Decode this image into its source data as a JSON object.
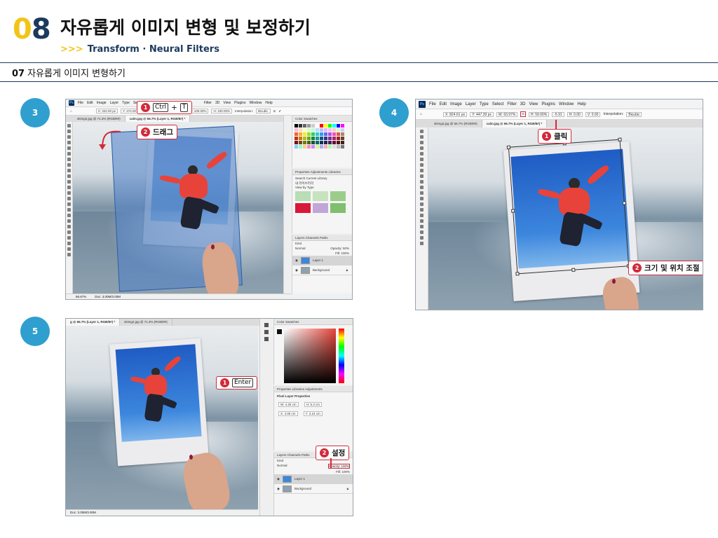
{
  "header": {
    "chapter_num_a": "0",
    "chapter_num_b": "8",
    "chapter_title": "자유롭게 이미지 변형 및 보정하기",
    "arrows": ">>>",
    "chapter_subtitle": "Transform · Neural Filters"
  },
  "section": {
    "number": "07",
    "title": "자유롭게 이미지 변형하기"
  },
  "colors": {
    "accent_yellow": "#f2c417",
    "navy": "#1b3a5c",
    "step_blue": "#2f9fcf",
    "callout_red": "#d12a3a"
  },
  "steps": [
    {
      "badge": "3",
      "menu": [
        "File",
        "Edit",
        "Image",
        "Layer",
        "Type",
        "Select",
        "Filter",
        "3D",
        "View",
        "Plugins",
        "Window",
        "Help"
      ],
      "options": [
        "X: 322.00 px",
        "Y: 474.00 px",
        "W: 100.00%",
        "H: 100.00%",
        "Interpolation:",
        "Bicubic"
      ],
      "tabs": [
        "skimg2.jpg @ 71.3% (RGB/8#)",
        "calm.jpg @ 66.7% (Layer 1, RGB/8#) *"
      ],
      "callout_1_num": "1",
      "callout_1_key_a": "Ctrl",
      "callout_1_plus": "+",
      "callout_1_key_b": "T",
      "callout_2_num": "2",
      "callout_2_text": "드래그",
      "status": "66.67%",
      "status_doc": "Doc: 3.00M/3.00M",
      "panel_tabs_top": "Color   Swatches",
      "panel_tabs_mid": "Properties   Adjustments   Libraries",
      "library_search": "Search Current Library",
      "library_name": "내 라이브러리",
      "library_view": "View by Type",
      "panel_tabs_layers": "Layers   Channels   Paths",
      "layer_kind": "Kind",
      "layer_mode": "Normal",
      "layer_opacity": "Opacity: 50%",
      "layer_fill": "Fill: 100%",
      "layers": [
        "Layer 1",
        "Background"
      ]
    },
    {
      "badge": "4",
      "menu": [
        "File",
        "Edit",
        "Image",
        "Layer",
        "Type",
        "Select",
        "Filter",
        "3D",
        "View",
        "Plugins",
        "Window",
        "Help"
      ],
      "options": [
        "X: 824.61 px",
        "Y: 447.39 px",
        "W: 63.97%",
        "H: 59.00%",
        "-5.91",
        "H: 0.00",
        "V: 0.00",
        "Interpolation:",
        "Bicubic"
      ],
      "tabs": [
        "skimg2.jpg @ 66.7% (RGB/8#)",
        "calm.jpg @ 66.7% (Layer 1, RGB/8#) *"
      ],
      "callout_1_num": "1",
      "callout_1_text": "클릭",
      "callout_2_num": "2",
      "callout_2_text": "크기 및 위치 조절"
    },
    {
      "badge": "5",
      "tabs": [
        "g @ 66.7% (Layer 1, RGB/8#) *",
        "skimg2.jpg @ 71.3% (RGB/8#)"
      ],
      "callout_1_num": "1",
      "callout_1_key": "Enter",
      "callout_2_num": "2",
      "callout_2_text": "설정",
      "status_doc": "Doc: 3.00M/3.00M",
      "panel_tabs_top": "Color   Swatches",
      "panel_tabs_mid": "Properties   Libraries   Adjustments",
      "props_title": "Pixel Layer Properties",
      "props_w": "W: 4.25 cm",
      "props_h": "H: 5.3 cm",
      "props_x": "X: 4.00 cm",
      "props_y": "Y: 3.24 cm",
      "panel_tabs_layers": "Layers   Channels   Paths",
      "layer_kind": "Kind",
      "layer_mode": "Normal",
      "layer_opacity": "Opacity: 100%",
      "layer_fill": "Fill: 100%",
      "layers": [
        "Layer 1",
        "Background"
      ]
    }
  ]
}
